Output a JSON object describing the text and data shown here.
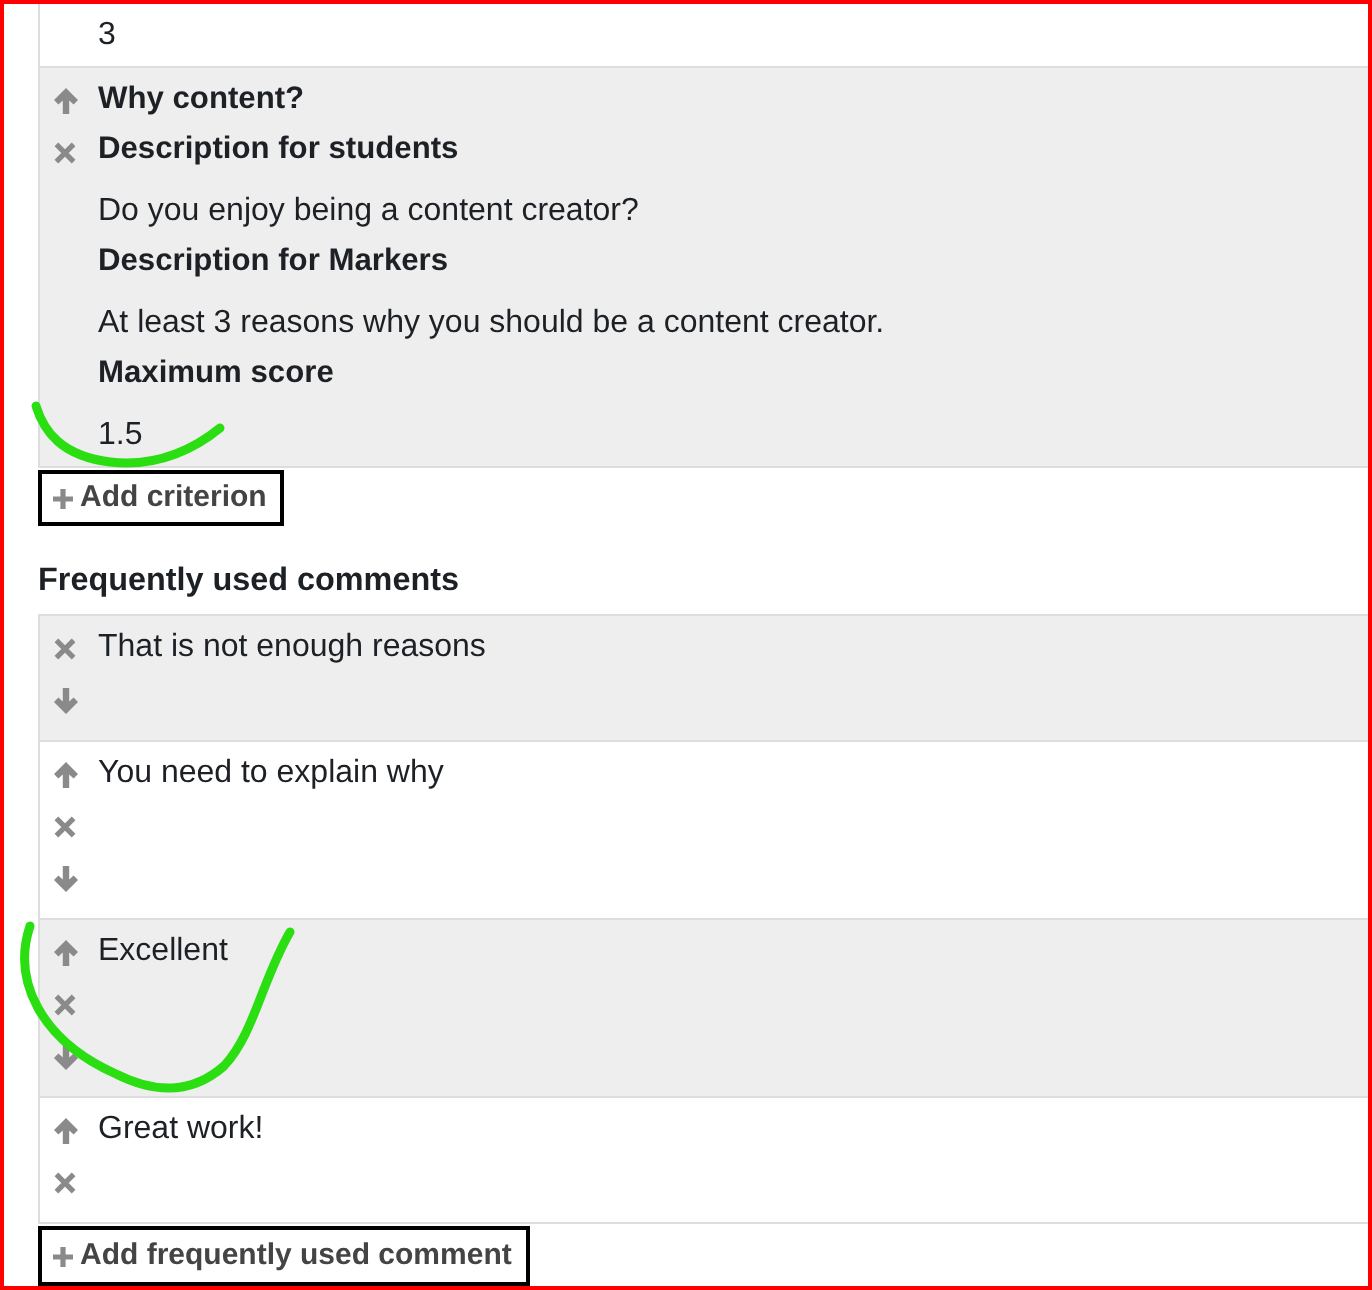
{
  "criteria": [
    {
      "move_up": false,
      "delete": false,
      "move_down": false,
      "fields": [
        {
          "value": "3"
        }
      ]
    },
    {
      "move_up": true,
      "delete": true,
      "move_down": false,
      "title": "Why content?",
      "fields": [
        {
          "label": "Description for students",
          "value": "Do you enjoy being a content creator?"
        },
        {
          "label": "Description for Markers",
          "value": "At least 3 reasons why you should be a content creator."
        },
        {
          "label": "Maximum score",
          "value": "1.5"
        }
      ]
    }
  ],
  "add_criterion_button": {
    "label": "Add criterion"
  },
  "comments_section": {
    "heading": "Frequently used comments",
    "comments": [
      {
        "text": "That is not enough reasons",
        "move_up": false,
        "delete": true,
        "move_down": true
      },
      {
        "text": "You need to explain why",
        "move_up": true,
        "delete": true,
        "move_down": true
      },
      {
        "text": "Excellent",
        "move_up": true,
        "delete": true,
        "move_down": true
      },
      {
        "text": "Great work!",
        "move_up": true,
        "delete": true,
        "move_down": false
      }
    ],
    "add_button": {
      "label": "Add frequently used comment"
    }
  }
}
